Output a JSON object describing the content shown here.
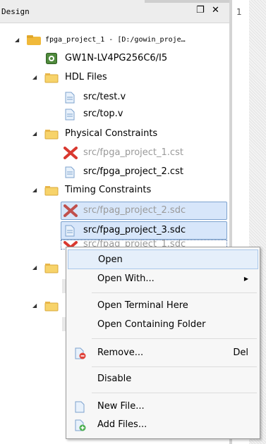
{
  "panel": {
    "title": "Design",
    "float_icon": "❐",
    "close_icon": "✕"
  },
  "editor": {
    "line_number": "1"
  },
  "tree": {
    "project": "fpga_project_1 - [D:/gowin_proje…",
    "device": "GW1N-LV4PG256C6/I5",
    "hdl_folder": "HDL Files",
    "hdl_files": [
      "src/test.v",
      "src/top.v"
    ],
    "phys_folder": "Physical Constraints",
    "phys_files": [
      "src/fpga_project_1.cst",
      "src/fpga_project_2.cst"
    ],
    "timing_folder": "Timing Constraints",
    "timing_files": [
      "src/fpag_project_2.sdc",
      "src/fpag_project_3.sdc",
      "src/fpag_project_1.sdc"
    ]
  },
  "context_menu": {
    "open": "Open",
    "open_with": "Open With...",
    "submenu_arrow": "▶",
    "open_terminal": "Open Terminal Here",
    "open_folder": "Open Containing Folder",
    "remove": "Remove...",
    "remove_shortcut": "Del",
    "disable": "Disable",
    "new_file": "New File...",
    "add_files": "Add Files..."
  },
  "colors": {
    "selection": "#d7e6fa",
    "folder": "#f2c94c",
    "error_x": "#d9382f"
  }
}
